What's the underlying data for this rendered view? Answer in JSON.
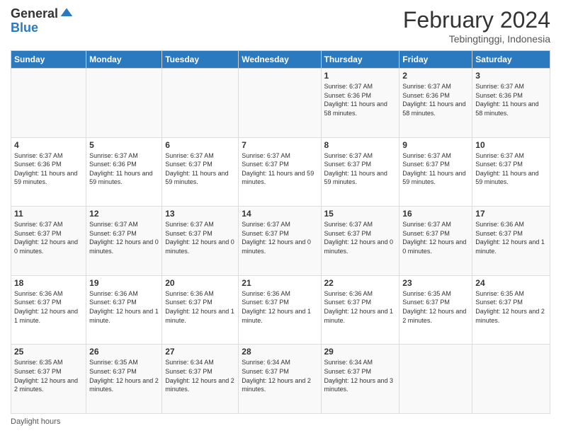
{
  "logo": {
    "general": "General",
    "blue": "Blue"
  },
  "header": {
    "month": "February 2024",
    "location": "Tebingtinggi, Indonesia"
  },
  "days_of_week": [
    "Sunday",
    "Monday",
    "Tuesday",
    "Wednesday",
    "Thursday",
    "Friday",
    "Saturday"
  ],
  "weeks": [
    [
      {
        "day": "",
        "sunrise": "",
        "sunset": "",
        "daylight": ""
      },
      {
        "day": "",
        "sunrise": "",
        "sunset": "",
        "daylight": ""
      },
      {
        "day": "",
        "sunrise": "",
        "sunset": "",
        "daylight": ""
      },
      {
        "day": "",
        "sunrise": "",
        "sunset": "",
        "daylight": ""
      },
      {
        "day": "1",
        "sunrise": "Sunrise: 6:37 AM",
        "sunset": "Sunset: 6:36 PM",
        "daylight": "Daylight: 11 hours and 58 minutes."
      },
      {
        "day": "2",
        "sunrise": "Sunrise: 6:37 AM",
        "sunset": "Sunset: 6:36 PM",
        "daylight": "Daylight: 11 hours and 58 minutes."
      },
      {
        "day": "3",
        "sunrise": "Sunrise: 6:37 AM",
        "sunset": "Sunset: 6:36 PM",
        "daylight": "Daylight: 11 hours and 58 minutes."
      }
    ],
    [
      {
        "day": "4",
        "sunrise": "Sunrise: 6:37 AM",
        "sunset": "Sunset: 6:36 PM",
        "daylight": "Daylight: 11 hours and 59 minutes."
      },
      {
        "day": "5",
        "sunrise": "Sunrise: 6:37 AM",
        "sunset": "Sunset: 6:36 PM",
        "daylight": "Daylight: 11 hours and 59 minutes."
      },
      {
        "day": "6",
        "sunrise": "Sunrise: 6:37 AM",
        "sunset": "Sunset: 6:37 PM",
        "daylight": "Daylight: 11 hours and 59 minutes."
      },
      {
        "day": "7",
        "sunrise": "Sunrise: 6:37 AM",
        "sunset": "Sunset: 6:37 PM",
        "daylight": "Daylight: 11 hours and 59 minutes."
      },
      {
        "day": "8",
        "sunrise": "Sunrise: 6:37 AM",
        "sunset": "Sunset: 6:37 PM",
        "daylight": "Daylight: 11 hours and 59 minutes."
      },
      {
        "day": "9",
        "sunrise": "Sunrise: 6:37 AM",
        "sunset": "Sunset: 6:37 PM",
        "daylight": "Daylight: 11 hours and 59 minutes."
      },
      {
        "day": "10",
        "sunrise": "Sunrise: 6:37 AM",
        "sunset": "Sunset: 6:37 PM",
        "daylight": "Daylight: 11 hours and 59 minutes."
      }
    ],
    [
      {
        "day": "11",
        "sunrise": "Sunrise: 6:37 AM",
        "sunset": "Sunset: 6:37 PM",
        "daylight": "Daylight: 12 hours and 0 minutes."
      },
      {
        "day": "12",
        "sunrise": "Sunrise: 6:37 AM",
        "sunset": "Sunset: 6:37 PM",
        "daylight": "Daylight: 12 hours and 0 minutes."
      },
      {
        "day": "13",
        "sunrise": "Sunrise: 6:37 AM",
        "sunset": "Sunset: 6:37 PM",
        "daylight": "Daylight: 12 hours and 0 minutes."
      },
      {
        "day": "14",
        "sunrise": "Sunrise: 6:37 AM",
        "sunset": "Sunset: 6:37 PM",
        "daylight": "Daylight: 12 hours and 0 minutes."
      },
      {
        "day": "15",
        "sunrise": "Sunrise: 6:37 AM",
        "sunset": "Sunset: 6:37 PM",
        "daylight": "Daylight: 12 hours and 0 minutes."
      },
      {
        "day": "16",
        "sunrise": "Sunrise: 6:37 AM",
        "sunset": "Sunset: 6:37 PM",
        "daylight": "Daylight: 12 hours and 0 minutes."
      },
      {
        "day": "17",
        "sunrise": "Sunrise: 6:36 AM",
        "sunset": "Sunset: 6:37 PM",
        "daylight": "Daylight: 12 hours and 1 minute."
      }
    ],
    [
      {
        "day": "18",
        "sunrise": "Sunrise: 6:36 AM",
        "sunset": "Sunset: 6:37 PM",
        "daylight": "Daylight: 12 hours and 1 minute."
      },
      {
        "day": "19",
        "sunrise": "Sunrise: 6:36 AM",
        "sunset": "Sunset: 6:37 PM",
        "daylight": "Daylight: 12 hours and 1 minute."
      },
      {
        "day": "20",
        "sunrise": "Sunrise: 6:36 AM",
        "sunset": "Sunset: 6:37 PM",
        "daylight": "Daylight: 12 hours and 1 minute."
      },
      {
        "day": "21",
        "sunrise": "Sunrise: 6:36 AM",
        "sunset": "Sunset: 6:37 PM",
        "daylight": "Daylight: 12 hours and 1 minute."
      },
      {
        "day": "22",
        "sunrise": "Sunrise: 6:36 AM",
        "sunset": "Sunset: 6:37 PM",
        "daylight": "Daylight: 12 hours and 1 minute."
      },
      {
        "day": "23",
        "sunrise": "Sunrise: 6:35 AM",
        "sunset": "Sunset: 6:37 PM",
        "daylight": "Daylight: 12 hours and 2 minutes."
      },
      {
        "day": "24",
        "sunrise": "Sunrise: 6:35 AM",
        "sunset": "Sunset: 6:37 PM",
        "daylight": "Daylight: 12 hours and 2 minutes."
      }
    ],
    [
      {
        "day": "25",
        "sunrise": "Sunrise: 6:35 AM",
        "sunset": "Sunset: 6:37 PM",
        "daylight": "Daylight: 12 hours and 2 minutes."
      },
      {
        "day": "26",
        "sunrise": "Sunrise: 6:35 AM",
        "sunset": "Sunset: 6:37 PM",
        "daylight": "Daylight: 12 hours and 2 minutes."
      },
      {
        "day": "27",
        "sunrise": "Sunrise: 6:34 AM",
        "sunset": "Sunset: 6:37 PM",
        "daylight": "Daylight: 12 hours and 2 minutes."
      },
      {
        "day": "28",
        "sunrise": "Sunrise: 6:34 AM",
        "sunset": "Sunset: 6:37 PM",
        "daylight": "Daylight: 12 hours and 2 minutes."
      },
      {
        "day": "29",
        "sunrise": "Sunrise: 6:34 AM",
        "sunset": "Sunset: 6:37 PM",
        "daylight": "Daylight: 12 hours and 3 minutes."
      },
      {
        "day": "",
        "sunrise": "",
        "sunset": "",
        "daylight": ""
      },
      {
        "day": "",
        "sunrise": "",
        "sunset": "",
        "daylight": ""
      }
    ]
  ],
  "footer": {
    "daylight_label": "Daylight hours"
  }
}
